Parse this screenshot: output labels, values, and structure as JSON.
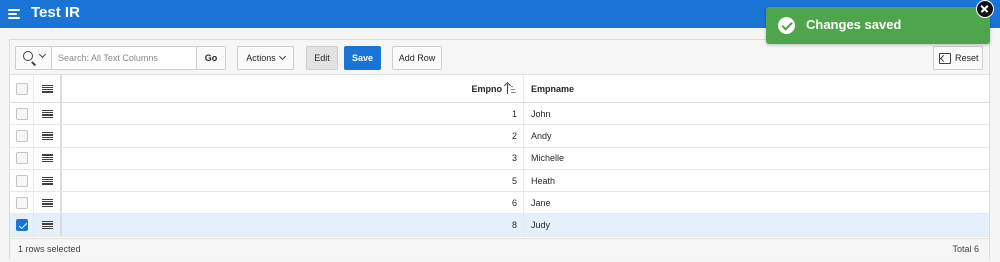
{
  "header": {
    "title": "Test IR"
  },
  "toolbar": {
    "search_placeholder": "Search: All Text Columns",
    "go_label": "Go",
    "actions_label": "Actions",
    "edit_label": "Edit",
    "save_label": "Save",
    "add_row_label": "Add Row",
    "reset_label": "Reset"
  },
  "grid": {
    "columns": [
      "Empno",
      "Empname"
    ],
    "sort": {
      "column": "Empno",
      "direction": "ascending"
    },
    "rows": [
      {
        "empno": "1",
        "empname": "John",
        "selected": false
      },
      {
        "empno": "2",
        "empname": "Andy",
        "selected": false
      },
      {
        "empno": "3",
        "empname": "Michelle",
        "selected": false
      },
      {
        "empno": "5",
        "empname": "Heath",
        "selected": false
      },
      {
        "empno": "6",
        "empname": "Jane",
        "selected": false
      },
      {
        "empno": "8",
        "empname": "Judy",
        "selected": true
      }
    ]
  },
  "footer": {
    "selection_text": "1 rows selected",
    "total_text": "Total 6"
  },
  "notification": {
    "message": "Changes saved",
    "type": "success"
  },
  "colors": {
    "header_bar": "#1a74d6",
    "primary_button": "#1a74d6",
    "success_toast": "#4ea54c",
    "selected_row": "#e6f0fb"
  }
}
